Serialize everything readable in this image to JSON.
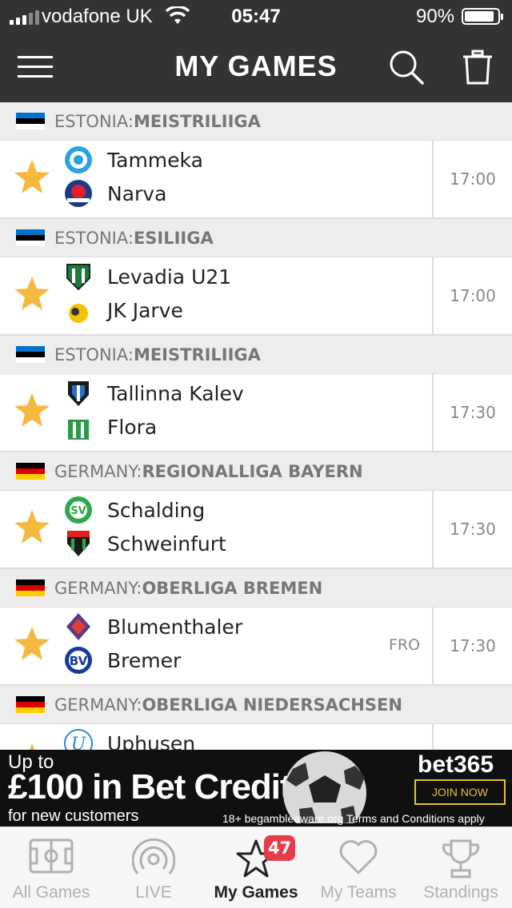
{
  "status_bar": {
    "carrier": "vodafone UK",
    "time": "05:47",
    "battery_percent": "90%",
    "battery_level": 0.9
  },
  "header": {
    "title": "MY GAMES",
    "menu_icon": "hamburger-icon",
    "search_icon": "search-icon",
    "trash_icon": "trash-icon"
  },
  "sections": [
    {
      "country": "ESTONIA: ",
      "competition": "MEISTRILIIGA",
      "flag_colors": [
        "#0072ce",
        "#000000",
        "#ffffff"
      ],
      "matches": [
        {
          "home": "Tammeka",
          "away": "Narva",
          "time": "17:00",
          "extra": "",
          "starred": true
        }
      ]
    },
    {
      "country": "ESTONIA: ",
      "competition": "ESILIIGA",
      "flag_colors": [
        "#0072ce",
        "#000000",
        "#ffffff"
      ],
      "matches": [
        {
          "home": "Levadia U21",
          "away": "JK Jarve",
          "time": "17:00",
          "extra": "",
          "starred": true
        }
      ]
    },
    {
      "country": "ESTONIA: ",
      "competition": "MEISTRILIIGA",
      "flag_colors": [
        "#0072ce",
        "#000000",
        "#ffffff"
      ],
      "matches": [
        {
          "home": "Tallinna Kalev",
          "away": "Flora",
          "time": "17:30",
          "extra": "",
          "starred": true
        }
      ]
    },
    {
      "country": "GERMANY: ",
      "competition": "REGIONALLIGA BAYERN",
      "flag_colors": [
        "#000000",
        "#dd0000",
        "#ffce00"
      ],
      "matches": [
        {
          "home": "Schalding",
          "away": "Schweinfurt",
          "time": "17:30",
          "extra": "",
          "starred": true
        }
      ]
    },
    {
      "country": "GERMANY: ",
      "competition": "OBERLIGA BREMEN",
      "flag_colors": [
        "#000000",
        "#dd0000",
        "#ffce00"
      ],
      "matches": [
        {
          "home": "Blumenthaler",
          "away": "Bremer",
          "time": "17:30",
          "extra": "FRO",
          "starred": true
        }
      ]
    },
    {
      "country": "GERMANY: ",
      "competition": "OBERLIGA NIEDERSACHSEN",
      "flag_colors": [
        "#000000",
        "#dd0000",
        "#ffce00"
      ],
      "matches": [
        {
          "home": "Uphusen",
          "away": "",
          "time": "",
          "extra": "",
          "starred": true
        }
      ]
    }
  ],
  "ad": {
    "line1": "Up to",
    "line2": "£100 in Bet Credits",
    "line3": "for new customers",
    "brand": "bet365",
    "cta": "JOIN NOW",
    "terms": "18+ begambleaware.org Terms and Conditions apply"
  },
  "tabs": [
    {
      "label": "All Games",
      "icon": "pitch-icon",
      "active": false
    },
    {
      "label": "LIVE",
      "icon": "live-broadcast-icon",
      "active": false
    },
    {
      "label": "My Games",
      "icon": "star-icon",
      "active": true,
      "badge": "47"
    },
    {
      "label": "My Teams",
      "icon": "heart-icon",
      "active": false
    },
    {
      "label": "Standings",
      "icon": "trophy-icon",
      "active": false
    }
  ],
  "colors": {
    "header_bg": "#333333",
    "star": "#f5b942",
    "badge": "#e53b4a",
    "ad_accent": "#e5c22e"
  }
}
